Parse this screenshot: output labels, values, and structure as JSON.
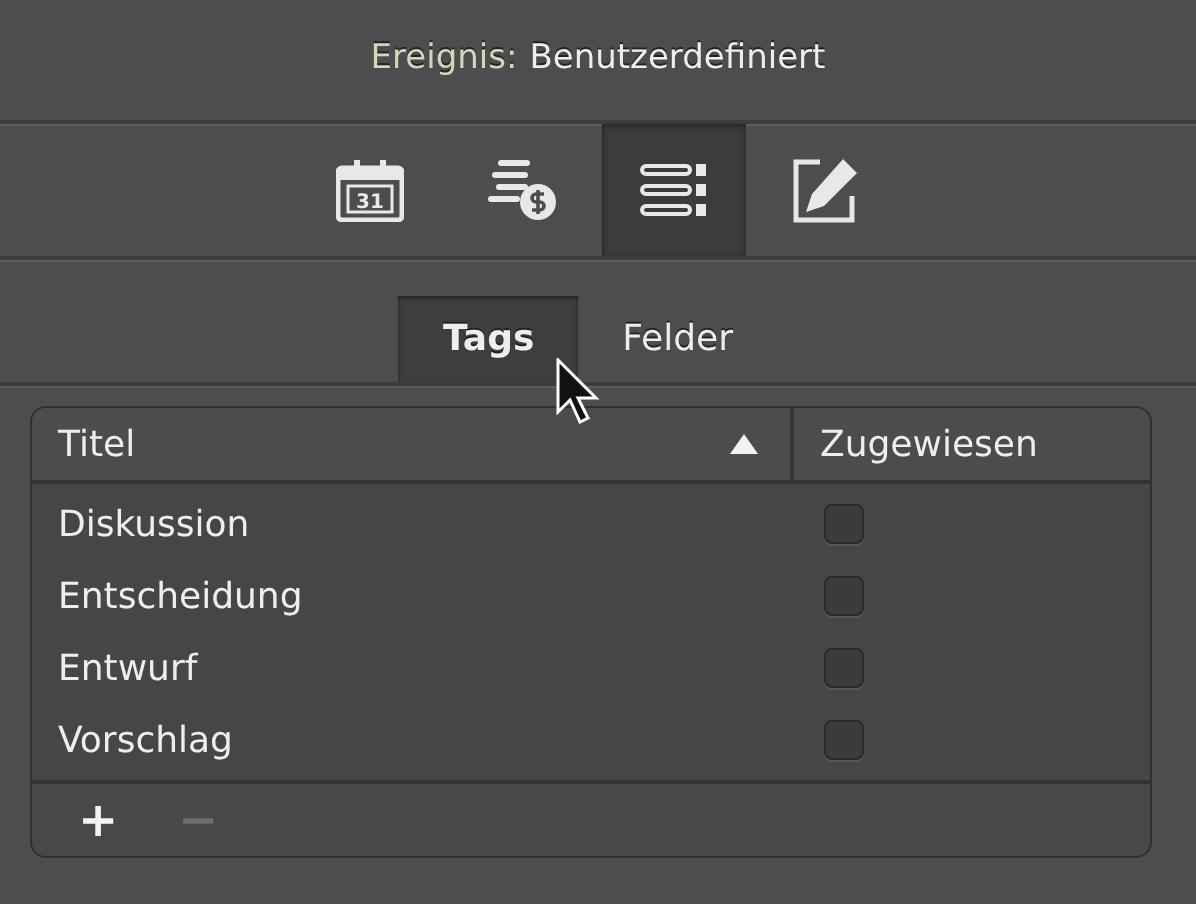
{
  "header": {
    "label": "Ereignis:",
    "value": "Benutzerdefiniert"
  },
  "toolbar": [
    {
      "kind": "calendar",
      "glyph": "31",
      "selected": false
    },
    {
      "kind": "money",
      "selected": false
    },
    {
      "kind": "list",
      "selected": true
    },
    {
      "kind": "edit",
      "selected": false
    }
  ],
  "tabs": [
    {
      "label": "Tags",
      "selected": true
    },
    {
      "label": "Felder",
      "selected": false
    }
  ],
  "table": {
    "columns": [
      {
        "label": "Titel",
        "sorted": true
      },
      {
        "label": "Zugewiesen",
        "sorted": false
      }
    ],
    "rows": [
      {
        "title": "Diskussion",
        "checked": false
      },
      {
        "title": "Entscheidung",
        "checked": false
      },
      {
        "title": "Entwurf",
        "checked": false
      },
      {
        "title": "Vorschlag",
        "checked": false
      }
    ],
    "footer_buttons": [
      {
        "label": "+",
        "disabled": false
      },
      {
        "label": "−",
        "disabled": true
      }
    ]
  }
}
